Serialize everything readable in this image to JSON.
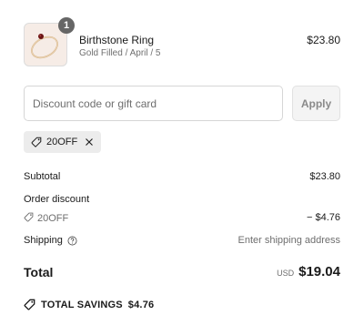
{
  "product": {
    "quantity": "1",
    "name": "Birthstone Ring",
    "variant": "Gold Filled / April / 5",
    "price": "$23.80"
  },
  "discount": {
    "placeholder": "Discount code or gift card",
    "value": "",
    "apply_label": "Apply",
    "applied_code": "20OFF"
  },
  "summary": {
    "subtotal_label": "Subtotal",
    "subtotal_value": "$23.80",
    "order_discount_label": "Order discount",
    "discount_code": "20OFF",
    "discount_value": "− $4.76",
    "shipping_label": "Shipping",
    "shipping_value": "Enter shipping address",
    "total_label": "Total",
    "currency": "USD",
    "total_value": "$19.04",
    "savings_label": "TOTAL SAVINGS",
    "savings_value": "$4.76"
  },
  "colors": {
    "badge": "#666666",
    "muted_text": "#6e6e6e",
    "chip_bg": "#ececec",
    "apply_bg": "#f4f4f4"
  },
  "icons": [
    "tag-icon",
    "close-icon",
    "help-circle-icon",
    "ring-image"
  ]
}
